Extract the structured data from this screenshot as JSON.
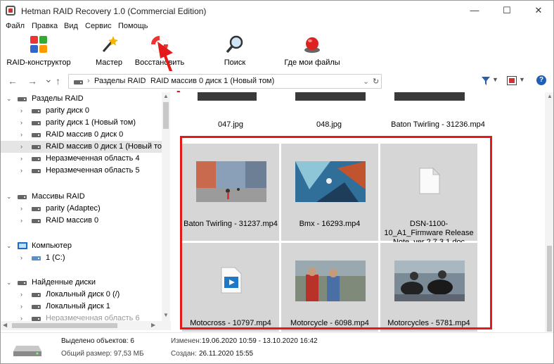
{
  "window": {
    "title": "Hetman RAID Recovery 1.0 (Commercial Edition)",
    "minimize": "—",
    "maximize": "☐",
    "close": "✕"
  },
  "menu": [
    "Файл",
    "Правка",
    "Вид",
    "Сервис",
    "Помощь"
  ],
  "toolbar": {
    "raid_builder": "RAID-конструктор",
    "wizard": "Мастер",
    "recover": "Восстановить",
    "search": "Поиск",
    "find_files": "Где мои файлы"
  },
  "address": {
    "back": "←",
    "forward": "→",
    "dropdown": "⌄",
    "up": "↑",
    "crumbs": [
      "Разделы RAID",
      "RAID массив 0 диск 1 (Новый том)"
    ],
    "refresh": "↻"
  },
  "tree": {
    "groups": [
      {
        "label": "Разделы RAID",
        "children": [
          "parity диск 0",
          "parity диск 1 (Новый том)",
          "RAID массив 0 диск 0",
          "RAID массив 0 диск 1 (Новый том)",
          "Неразмеченная область 4",
          "Неразмеченная область 5"
        ]
      },
      {
        "label": "Массивы RAID",
        "children": [
          "parity (Adaptec)",
          "RAID массив 0"
        ]
      },
      {
        "label": "Компьютер",
        "children": [
          "1 (C:)"
        ]
      },
      {
        "label": "Найденные диски",
        "children": [
          "Локальный диск 0 (/)",
          "Локальный диск 1",
          "Неразмеченная область 6"
        ]
      }
    ],
    "selected": "RAID массив 0 диск 1 (Новый том)"
  },
  "files": {
    "top_row": [
      "047.jpg",
      "048.jpg",
      "Baton Twirling - 31236.mp4"
    ],
    "row1": [
      "Baton Twirling - 31237.mp4",
      "Bmx - 16293.mp4",
      "DSN-1100-10_A1_Firmware Release Note_ver 2.7.3.1.doc"
    ],
    "row2": [
      "Motocross - 10797.mp4",
      "Motorcycle - 6098.mp4",
      "Motorcycles - 5781.mp4"
    ]
  },
  "status": {
    "selected": "Выделено объектов: 6",
    "total": "Общий размер: 97,53 МБ",
    "modified_label": "Изменен:",
    "modified": "19.06.2020 10:59 - 13.10.2020 16:42",
    "created_label": "Создан:",
    "created": "26.11.2020 15:55"
  },
  "colors": {
    "highlight": "#e21a1a",
    "tile": "#d6d6d6",
    "selection": "#e5e5e5"
  }
}
